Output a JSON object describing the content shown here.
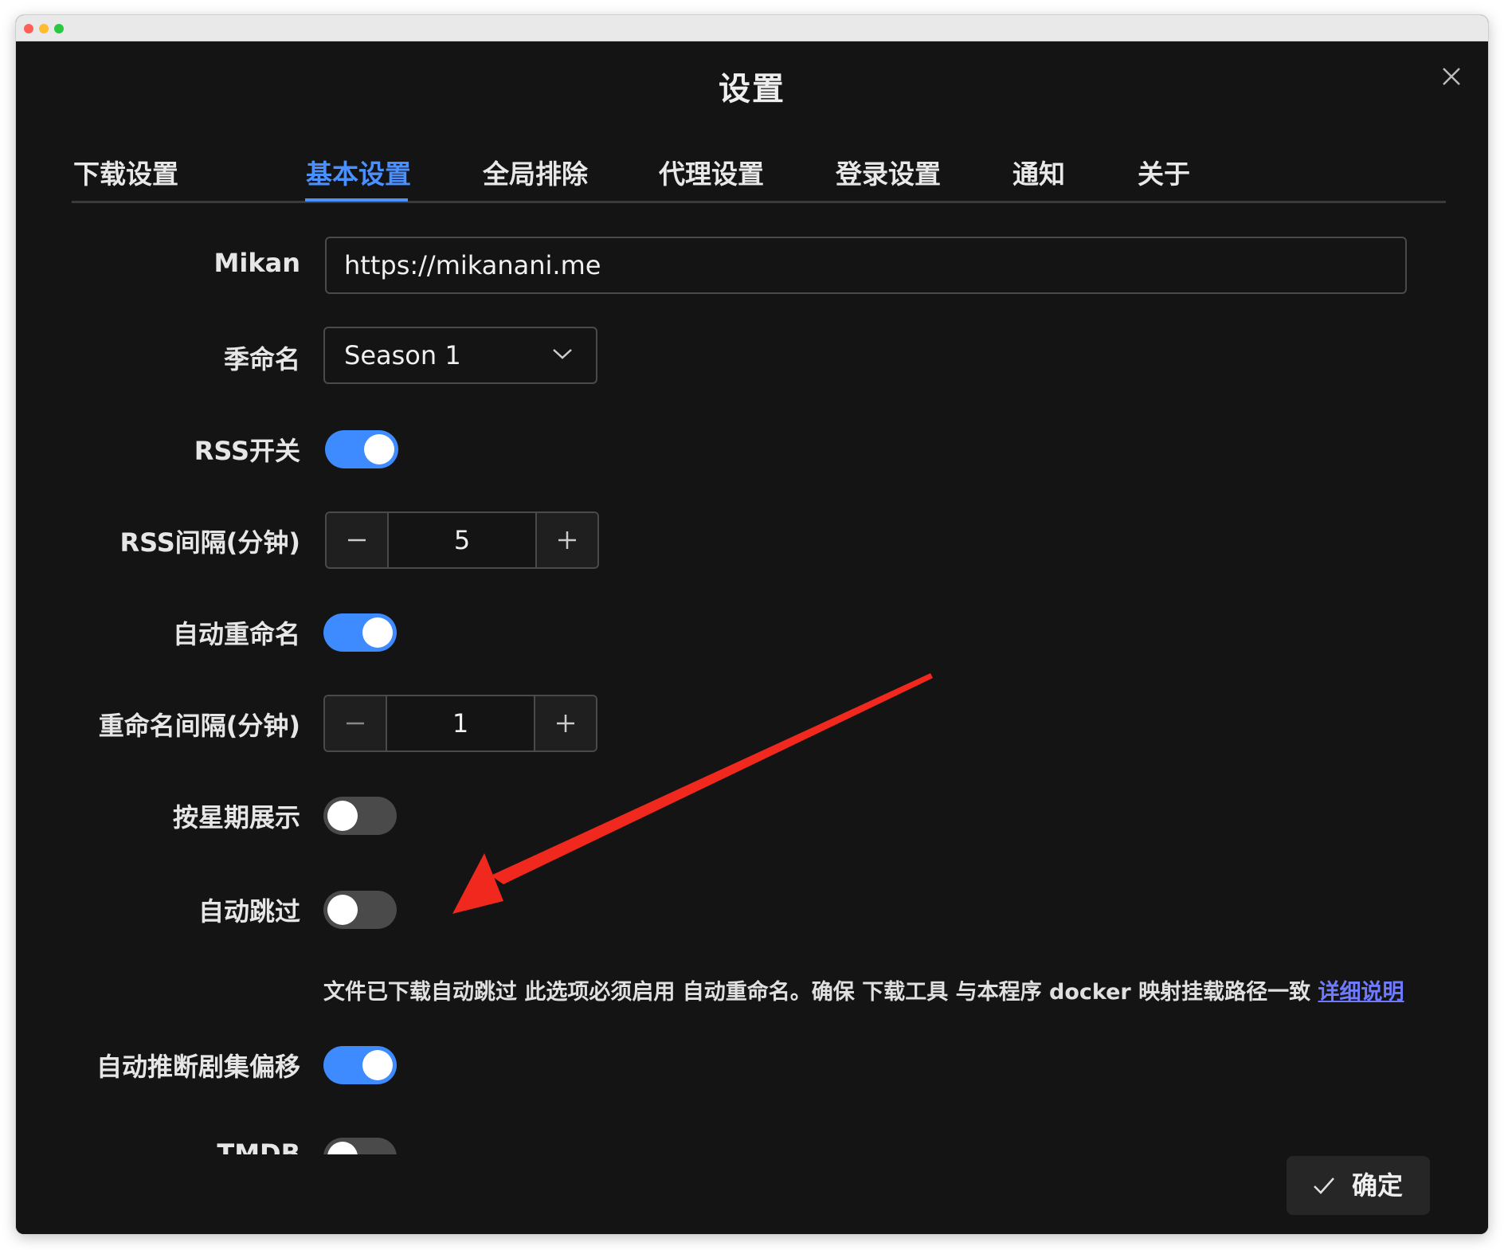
{
  "dialog": {
    "title": "设置",
    "close_icon": "close-icon"
  },
  "tabs": [
    {
      "label": "下载设置",
      "active": false
    },
    {
      "label": "基本设置",
      "active": true
    },
    {
      "label": "全局排除",
      "active": false
    },
    {
      "label": "代理设置",
      "active": false
    },
    {
      "label": "登录设置",
      "active": false
    },
    {
      "label": "通知",
      "active": false
    },
    {
      "label": "关于",
      "active": false
    }
  ],
  "form": {
    "mikan": {
      "label": "Mikan",
      "value": "https://mikanani.me"
    },
    "season_name": {
      "label": "季命名",
      "value": "Season 1"
    },
    "rss_switch": {
      "label": "RSS开关",
      "on": true
    },
    "rss_interval": {
      "label": "RSS间隔(分钟)",
      "value": "5"
    },
    "auto_rename": {
      "label": "自动重命名",
      "on": true
    },
    "rename_interval": {
      "label": "重命名间隔(分钟)",
      "value": "1"
    },
    "weekday_display": {
      "label": "按星期展示",
      "on": false
    },
    "auto_skip": {
      "label": "自动跳过",
      "on": false,
      "help": "文件已下载自动跳过 此选项必须启用 自动重命名。确保 下载工具 与本程序 docker 映射挂载路径一致",
      "help_link": "详细说明"
    },
    "auto_offset": {
      "label": "自动推断剧集偏移",
      "on": true
    },
    "tmdb": {
      "label": "TMDB",
      "on": false
    }
  },
  "footer": {
    "confirm_label": "确定"
  },
  "colors": {
    "accent": "#3d8bff",
    "background": "#141414",
    "annotation_arrow": "#f0281e"
  }
}
